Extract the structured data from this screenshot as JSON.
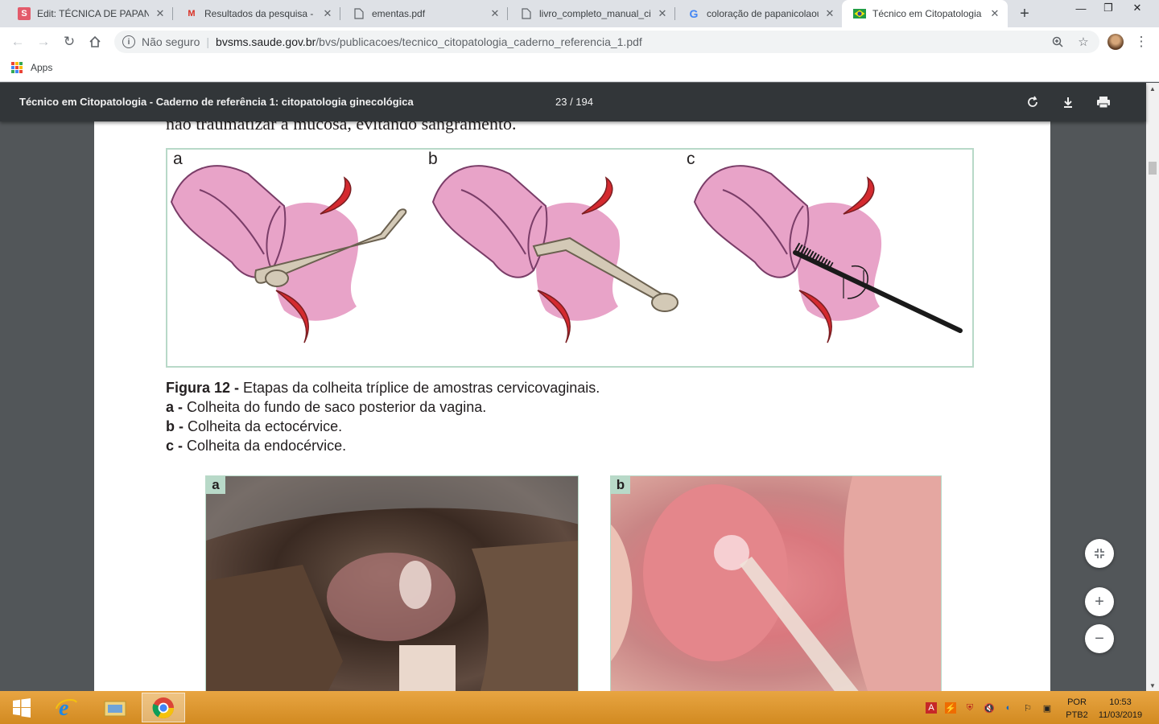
{
  "browser": {
    "tabs": [
      {
        "title": "Edit: TÉCNICA DE PAPANIC",
        "favicon": "S"
      },
      {
        "title": "Resultados da pesquisa - k",
        "favicon": "M"
      },
      {
        "title": "ementas.pdf",
        "favicon": "doc-icon"
      },
      {
        "title": "livro_completo_manual_citi",
        "favicon": "doc-icon"
      },
      {
        "title": "coloração de papanicolaou",
        "favicon": "G"
      },
      {
        "title": "Técnico em Citopatologia -",
        "favicon": "flag-icon",
        "active": true
      }
    ],
    "omnibox": {
      "security_label": "Não seguro",
      "url_host": "bvsms.saude.gov.br",
      "url_path": "/bvs/publicacoes/tecnico_citopatologia_caderno_referencia_1.pdf"
    },
    "bookmarks": {
      "apps_label": "Apps"
    }
  },
  "pdf": {
    "title": "Técnico em Citopatologia - Caderno de referência 1: citopatologia ginecológica",
    "page_indicator": "23 / 194"
  },
  "document": {
    "prev_text": "não traumatizar a mucosa, evitando sangramento.",
    "figure_panels": [
      "a",
      "b",
      "c"
    ],
    "caption": {
      "title_bold": "Figura 12 - ",
      "title_text": "Etapas da colheita tríplice de amostras cervicovaginais.",
      "lines": [
        {
          "bold": "a - ",
          "text": "Colheita do fundo de saco posterior da vagina."
        },
        {
          "bold": "b - ",
          "text": "Colheita da ectocérvice."
        },
        {
          "bold": "c - ",
          "text": "Colheita da endocérvice."
        }
      ]
    },
    "photos": [
      {
        "label": "a"
      },
      {
        "label": "b"
      }
    ]
  },
  "taskbar": {
    "lang_top": "POR",
    "lang_bottom": "PTB2",
    "time": "10:53",
    "date": "11/03/2019"
  },
  "colors": {
    "tissue_pink": "#e8a3c8",
    "tissue_pink_dark": "#d98cba",
    "mucosa_red": "#d42a2f",
    "swab_beige": "#d3c9b6",
    "frame_green": "#b8d9c8",
    "taskbar_orange": "#e09a33"
  }
}
